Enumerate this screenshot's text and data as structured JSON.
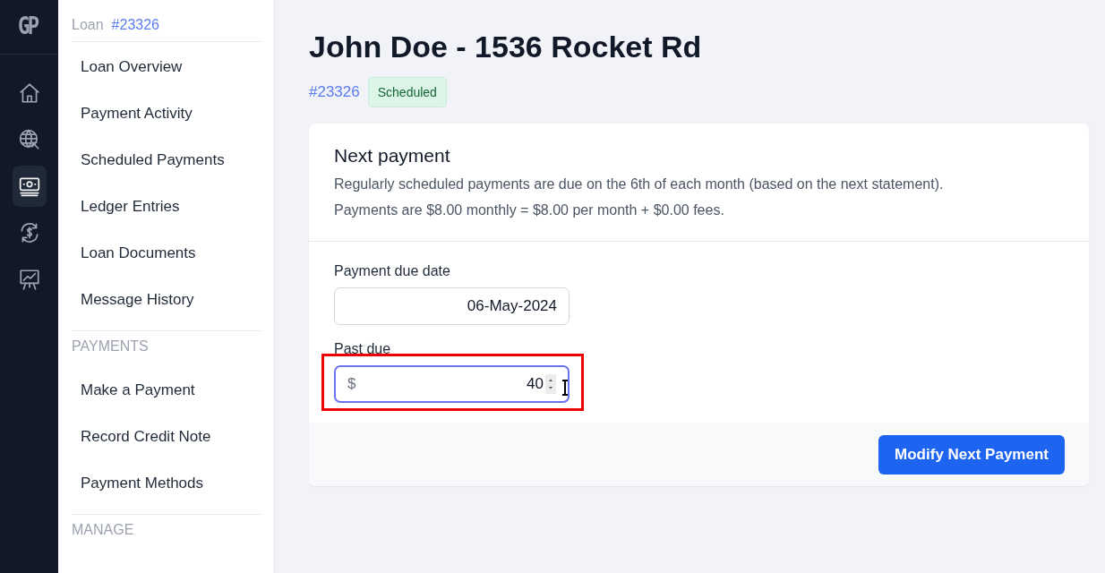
{
  "rail": {
    "logo": "GP",
    "items": [
      {
        "kind": "home",
        "selected": false
      },
      {
        "kind": "globe",
        "selected": false
      },
      {
        "kind": "cash",
        "selected": true
      },
      {
        "kind": "exchange",
        "selected": false
      },
      {
        "kind": "chart",
        "selected": false
      }
    ]
  },
  "sidebar": {
    "header": {
      "label": "Loan",
      "number": "#23326"
    },
    "groups": [
      {
        "items": [
          "Loan Overview",
          "Payment Activity",
          "Scheduled Payments",
          "Ledger Entries",
          "Loan Documents",
          "Message History"
        ]
      },
      {
        "title": "PAYMENTS",
        "items": [
          "Make a Payment",
          "Record Credit Note",
          "Payment Methods"
        ]
      },
      {
        "title": "MANAGE"
      }
    ]
  },
  "page": {
    "title": "John Doe - 1536 Rocket Rd",
    "loan_number": "#23326",
    "status": "Scheduled"
  },
  "card": {
    "title": "Next payment",
    "lines": [
      "Regularly scheduled payments are due on the 6th of each month (based on the next statement).",
      "Payments are $8.00 monthly = $8.00 per month + $0.00 fees."
    ],
    "fields": [
      {
        "kind": "date",
        "label": "Payment due date",
        "value": "06-May-2024",
        "focused": false,
        "highlighted": false
      },
      {
        "kind": "amount",
        "label": "Past due",
        "prefix": "$",
        "value": "40",
        "focused": true,
        "highlighted": true
      }
    ],
    "button": "Modify Next Payment"
  }
}
